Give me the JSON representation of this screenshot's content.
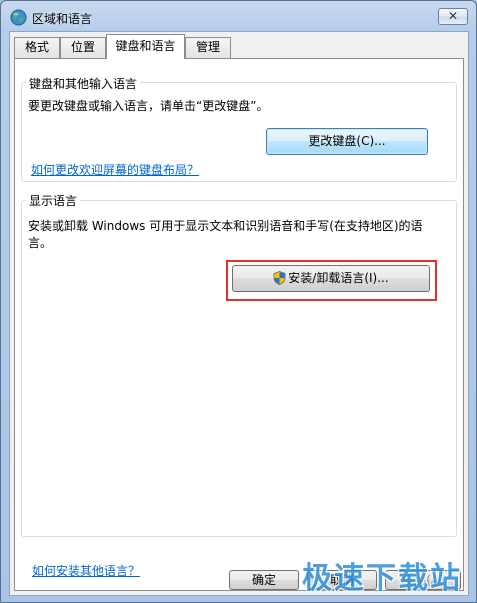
{
  "window": {
    "title": "区域和语言",
    "close_label": "✕"
  },
  "tabs": [
    {
      "label": "格式",
      "active": false
    },
    {
      "label": "位置",
      "active": false
    },
    {
      "label": "键盘和语言",
      "active": true
    },
    {
      "label": "管理",
      "active": false
    }
  ],
  "keyboard_group": {
    "title": "键盘和其他输入语言",
    "description": "要更改键盘或输入语言，请单击“更改键盘”。",
    "change_button": "更改键盘(C)...",
    "welcome_link": "如何更改欢迎屏幕的键盘布局？"
  },
  "display_group": {
    "title": "显示语言",
    "description_line1": "安装或卸载 Windows 可用于显示文本和识别语音和手写(在支持地区)的语",
    "description_line2": "言。",
    "install_button": "安装/卸载语言(I)..."
  },
  "footer": {
    "help_link": "如何安装其他语言？",
    "ok_button": "确定",
    "cancel_button": "取消",
    "apply_button": "应用(A)"
  },
  "watermark": "极速下载站",
  "colors": {
    "link": "#0066cc",
    "highlight": "#e03030",
    "watermark": "#2e8fd8"
  }
}
